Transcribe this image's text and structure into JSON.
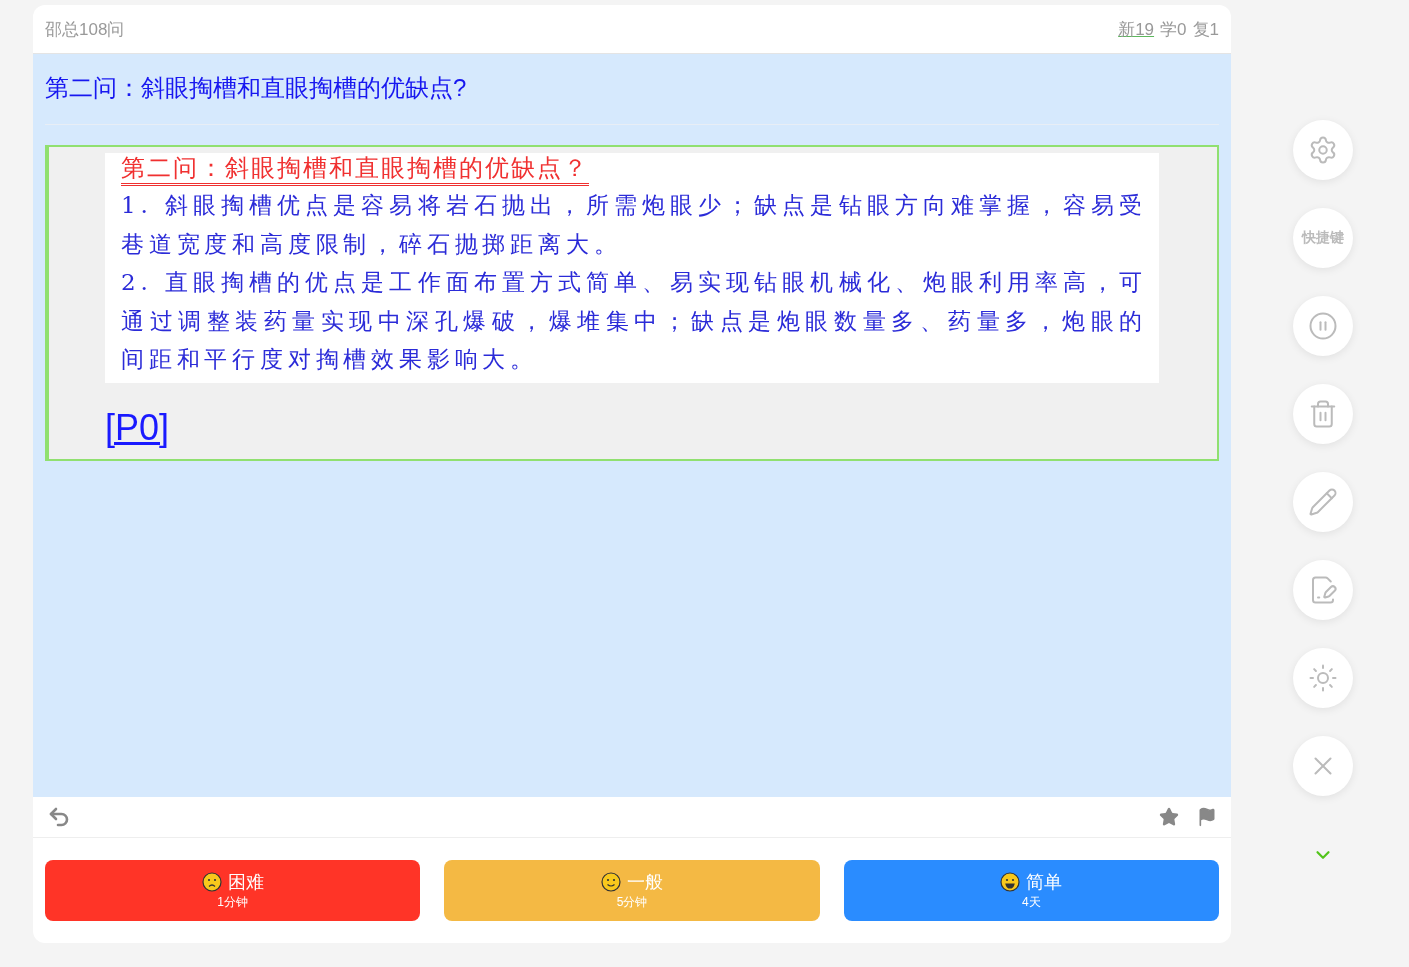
{
  "header": {
    "deck": "邵总108问",
    "stats": [
      {
        "kind": "new",
        "label": "新19"
      },
      {
        "kind": "learn",
        "label": "学0"
      },
      {
        "kind": "review",
        "label": "复1"
      }
    ]
  },
  "question": "第二问：斜眼掏槽和直眼掏槽的优缺点?",
  "answer": {
    "document": {
      "title": "第二问：斜眼掏槽和直眼掏槽的优缺点？",
      "paragraphs": [
        "1. 斜眼掏槽优点是容易将岩石抛出，所需炮眼少；缺点是钻眼方向难掌握，容易受巷道宽度和高度限制，碎石抛掷距离大。",
        "2. 直眼掏槽的优点是工作面布置方式简单、易实现钻眼机械化、炮眼利用率高，可通过调整装药量实现中深孔爆破，爆堆集中；缺点是炮眼数量多、药量多，炮眼的间距和平行度对掏槽效果影响大。"
      ]
    },
    "link": "[P0]"
  },
  "ratings": [
    {
      "kind": "hard",
      "label": "困难",
      "time": "1分钟"
    },
    {
      "kind": "normal",
      "label": "一般",
      "time": "5分钟"
    },
    {
      "kind": "easy",
      "label": "简单",
      "time": "4天"
    }
  ],
  "side_panel": {
    "shortcut_label": "快捷键"
  }
}
